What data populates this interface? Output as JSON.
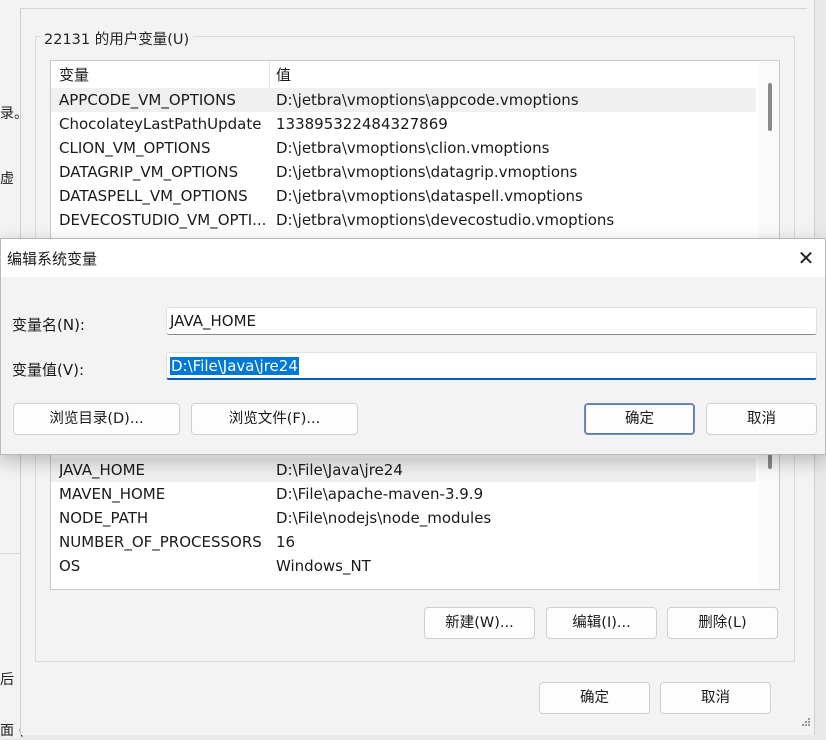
{
  "parent_window_fragments": [
    "录。",
    "虚",
    "后",
    "面 ("
  ],
  "env_window": {
    "group_title": "22131 的用户变量(U)",
    "columns": [
      "变量",
      "值"
    ],
    "rows_top": [
      {
        "name": "APPCODE_VM_OPTIONS",
        "value": "D:\\jetbra\\vmoptions\\appcode.vmoptions"
      },
      {
        "name": "ChocolateyLastPathUpdate",
        "value": "133895322484327869"
      },
      {
        "name": "CLION_VM_OPTIONS",
        "value": "D:\\jetbra\\vmoptions\\clion.vmoptions"
      },
      {
        "name": "DATAGRIP_VM_OPTIONS",
        "value": "D:\\jetbra\\vmoptions\\datagrip.vmoptions"
      },
      {
        "name": "DATASPELL_VM_OPTIONS",
        "value": "D:\\jetbra\\vmoptions\\dataspell.vmoptions"
      },
      {
        "name": "DEVECOSTUDIO_VM_OPTI...",
        "value": "D:\\jetbra\\vmoptions\\devecostudio.vmoptions"
      }
    ],
    "rows_bottom": [
      {
        "name": "JAVA_HOME",
        "value": "D:\\File\\Java\\jre24"
      },
      {
        "name": "MAVEN_HOME",
        "value": "D:\\File\\apache-maven-3.9.9"
      },
      {
        "name": "NODE_PATH",
        "value": "D:\\File\\nodejs\\node_modules"
      },
      {
        "name": "NUMBER_OF_PROCESSORS",
        "value": "16"
      },
      {
        "name": "OS",
        "value": "Windows_NT"
      }
    ],
    "buttons": {
      "new": "新建(W)...",
      "edit": "编辑(I)...",
      "delete": "删除(L)"
    },
    "footer": {
      "ok": "确定",
      "cancel": "取消"
    }
  },
  "dialog": {
    "title": "编辑系统变量",
    "close_glyph": "✕",
    "name_label": "变量名(N):",
    "name_value": "JAVA_HOME",
    "value_label": "变量值(V):",
    "value_value": "D:\\File\\Java\\jre24",
    "browse_dir": "浏览目录(D)...",
    "browse_file": "浏览文件(F)...",
    "ok": "确定",
    "cancel": "取消"
  },
  "colors": {
    "accent": "#0078d7",
    "focus_underline": "#005fb8"
  }
}
